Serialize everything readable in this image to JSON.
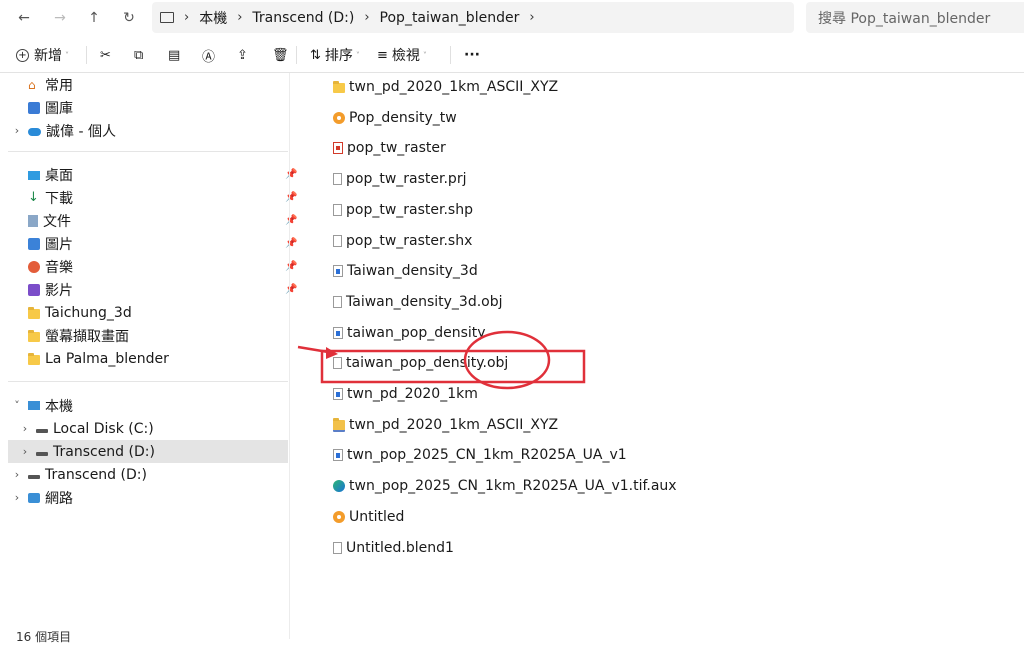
{
  "address_bar": {
    "breadcrumb": [
      "本機",
      "Transcend (D:)",
      "Pop_taiwan_blender"
    ],
    "search_placeholder": "搜尋 Pop_taiwan_blender"
  },
  "toolbar": {
    "new_label": "新增",
    "sort_label": "排序",
    "view_label": "檢視",
    "more_label": "···"
  },
  "nav": {
    "top": [
      {
        "label": "常用"
      },
      {
        "label": "圖庫"
      },
      {
        "label": "誠偉 - 個人"
      }
    ],
    "pinned": [
      {
        "label": "桌面"
      },
      {
        "label": "下載"
      },
      {
        "label": "文件"
      },
      {
        "label": "圖片"
      },
      {
        "label": "音樂"
      },
      {
        "label": "影片"
      },
      {
        "label": "Taichung_3d"
      },
      {
        "label": "螢幕擷取畫面"
      },
      {
        "label": "La Palma_blender"
      }
    ],
    "this_pc": {
      "label": "本機"
    },
    "drives": [
      {
        "label": "Local Disk (C:)"
      },
      {
        "label": "Transcend (D:)"
      }
    ],
    "transcend": {
      "label": "Transcend (D:)"
    },
    "network": {
      "label": "網路"
    }
  },
  "files": [
    {
      "name": "twn_pd_2020_1km_ASCII_XYZ",
      "icon": "folder-icon"
    },
    {
      "name": "Pop_density_tw",
      "icon": "blender-icon"
    },
    {
      "name": "pop_tw_raster",
      "icon": "pdf-icon"
    },
    {
      "name": "pop_tw_raster.prj",
      "icon": "file-icon"
    },
    {
      "name": "pop_tw_raster.shp",
      "icon": "file-icon"
    },
    {
      "name": "pop_tw_raster.shx",
      "icon": "file-icon"
    },
    {
      "name": "Taiwan_density_3d",
      "icon": "obj-icon"
    },
    {
      "name": "Taiwan_density_3d.obj",
      "icon": "file-icon"
    },
    {
      "name": "taiwan_pop_density",
      "icon": "obj-icon"
    },
    {
      "name": "taiwan_pop_density.obj",
      "icon": "file-icon"
    },
    {
      "name": "twn_pd_2020_1km",
      "icon": "obj-icon"
    },
    {
      "name": "twn_pd_2020_1km_ASCII_XYZ",
      "icon": "zip-folder-icon"
    },
    {
      "name": "twn_pop_2025_CN_1km_R2025A_UA_v1",
      "icon": "obj-icon"
    },
    {
      "name": "twn_pop_2025_CN_1km_R2025A_UA_v1.tif.aux",
      "icon": "edge-icon"
    },
    {
      "name": "Untitled",
      "icon": "blender-icon"
    },
    {
      "name": "Untitled.blend1",
      "icon": "file-icon"
    }
  ],
  "status": {
    "item_count": "16 個項目"
  },
  "colors": {
    "annotation": "#e0303a",
    "selection": "#e4e4e4"
  }
}
